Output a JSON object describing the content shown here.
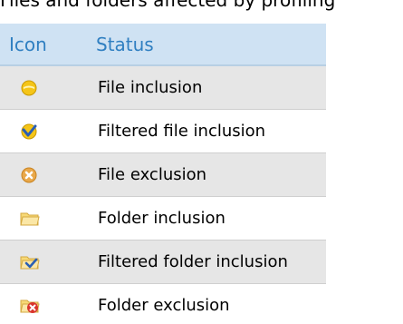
{
  "caption": "Files and folders affected by profiling",
  "table": {
    "headers": {
      "icon": "Icon",
      "status": "Status"
    },
    "rows": [
      {
        "icon": "file-inclusion-icon",
        "status": "File inclusion"
      },
      {
        "icon": "filtered-file-inclusion-icon",
        "status": "Filtered file inclusion"
      },
      {
        "icon": "file-exclusion-icon",
        "status": "File exclusion"
      },
      {
        "icon": "folder-inclusion-icon",
        "status": "Folder inclusion"
      },
      {
        "icon": "filtered-folder-inclusion-icon",
        "status": "Filtered folder inclusion"
      },
      {
        "icon": "folder-exclusion-icon",
        "status": "Folder exclusion"
      }
    ]
  },
  "colors": {
    "header_bg": "#cfe2f3",
    "header_text": "#2f7fc1",
    "row_alt_bg": "#e6e6e6",
    "icon_yellow": "#f5c518",
    "check_blue": "#2b5fb3",
    "exclusion_red": "#d9342b"
  }
}
